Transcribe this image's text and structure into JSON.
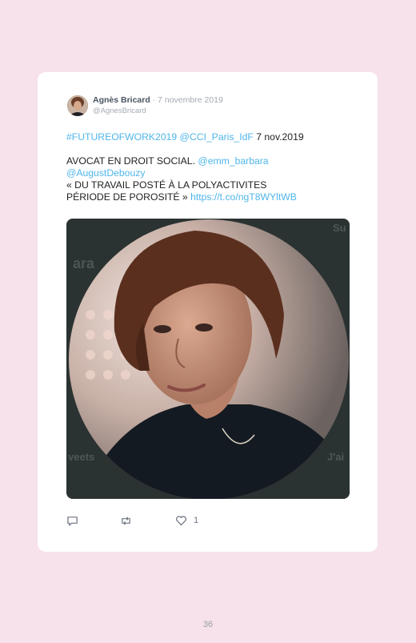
{
  "tweet": {
    "author_name": "Agnès Bricard",
    "date": " · 7 novembre 2019",
    "handle": "@AgnesBricard",
    "line1_hashtag": "#FUTUREOFWORK2019",
    "line1_mention": "@CCI_Paris_IdF",
    "line1_date": " 7 nov.2019",
    "line2_text": "AVOCAT EN DROIT SOCIAL. ",
    "line2_mention": "@emm_barbara",
    "line3_mention": "@AugustDebouzy",
    "line4_text": "« DU TRAVAIL POSTÉ À LA POLYACTIVITES",
    "line5_text": "PÉRIODE DE POROSITÉ » ",
    "line5_link": "https://t.co/ngT8WYltWB",
    "like_count": "1"
  },
  "media": {
    "bg_text_1": "ara",
    "bg_text_2": "veets",
    "bg_text_3": "J'ai",
    "bg_text_4": "Su"
  },
  "icons": [
    "reply-icon",
    "retweet-icon",
    "heart-icon"
  ],
  "colors": {
    "page_bg": "#f7e1ea",
    "link": "#4fb5ea"
  },
  "page": {
    "number": "36"
  }
}
